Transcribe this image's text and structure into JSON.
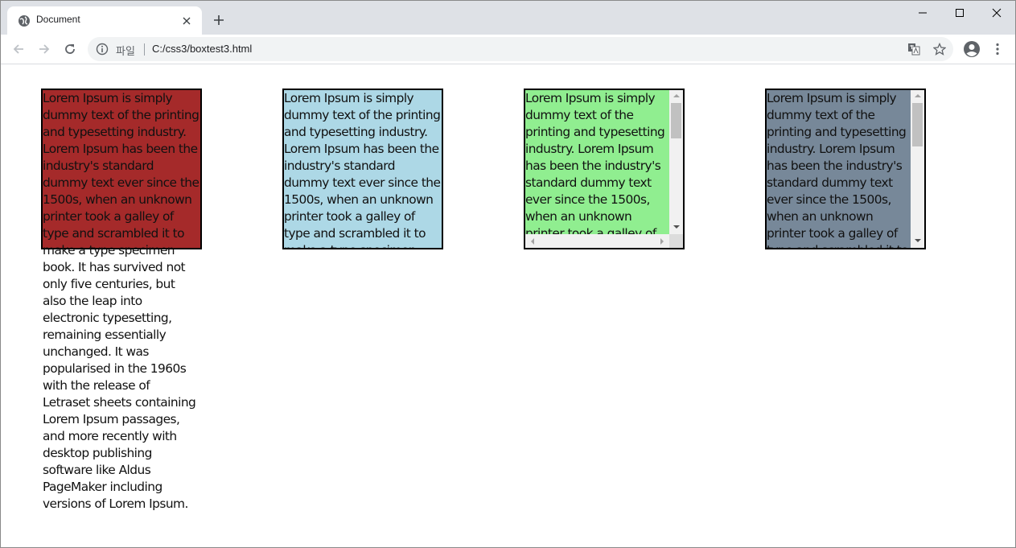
{
  "browser": {
    "tab_title": "Document",
    "address_scheme_label": "파일",
    "address_url": "C:/css3/boxtest3.html"
  },
  "page": {
    "lorem_text": "Lorem Ipsum is simply dummy text of the printing and typesetting industry. Lorem Ipsum has been the industry's standard dummy text ever since the 1500s, when an unknown printer took a galley of type and scrambled it to make a type specimen book. It has survived not only five centuries, but also the leap into electronic typesetting, remaining essentially unchanged. It was popularised in the 1960s with the release of Letraset sheets containing Lorem Ipsum passages, and more recently with desktop publishing software like Aldus PageMaker including versions of Lorem Ipsum.",
    "boxes": [
      {
        "overflow": "visible",
        "background": "#a52a2a"
      },
      {
        "overflow": "hidden",
        "background": "#add8e6"
      },
      {
        "overflow": "scroll",
        "background": "#90ee90"
      },
      {
        "overflow": "auto",
        "background": "#778899"
      }
    ]
  },
  "colors": {
    "tabstrip": "#dee1e6",
    "omnibox": "#f1f3f4"
  },
  "icons": [
    "globe-icon",
    "close-icon",
    "plus-icon",
    "minimize-icon",
    "maximize-icon",
    "window-close-icon",
    "back-icon",
    "forward-icon",
    "reload-icon",
    "info-icon",
    "translate-icon",
    "star-icon",
    "account-icon",
    "menu-icon"
  ]
}
